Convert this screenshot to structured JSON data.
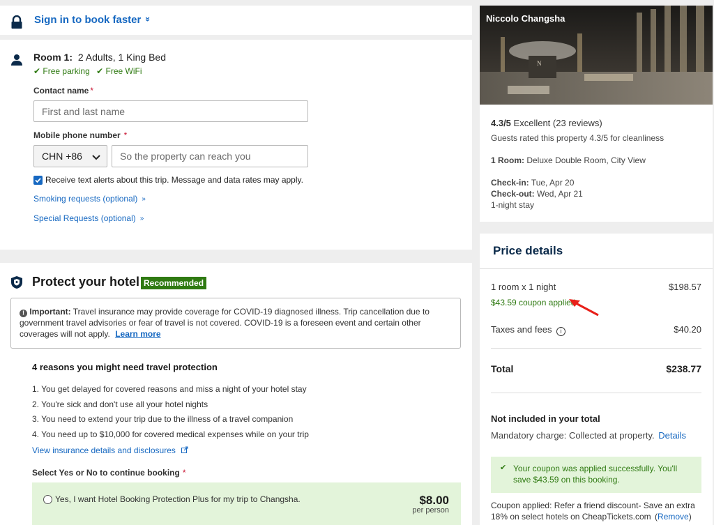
{
  "signin": {
    "label": "Sign in to book faster",
    "chevron": "»"
  },
  "room": {
    "title": "Room 1:",
    "details": "2 Adults, 1 King Bed",
    "amenities": [
      "Free parking",
      "Free WiFi"
    ],
    "contact_label": "Contact name",
    "contact_placeholder": "First and last name",
    "phone_label": "Mobile phone number",
    "country_code": "CHN +86",
    "phone_placeholder": "So the property can reach you",
    "sms_label": "Receive text alerts about this trip. Message and data rates may apply.",
    "sms_checked": true,
    "smoking_link": "Smoking requests (optional)",
    "special_link": "Special Requests (optional)"
  },
  "protect": {
    "title": "Protect your hotel",
    "badge": "Recommended",
    "important_label": "Important:",
    "important_text": "Travel insurance may provide coverage for COVID-19 diagnosed illness. Trip cancellation due to government travel advisories or fear of travel is not covered. COVID-19 is a foreseen event and certain other coverages will not apply.",
    "learn_more": "Learn more",
    "reasons_title": "4 reasons you might need travel protection",
    "reasons": [
      "1. You get delayed for covered reasons and miss a night of your hotel stay",
      "2. You're sick and don't use all your hotel nights",
      "3. You need to extend your trip due to the illness of a travel companion",
      "4. You need up to $10,000 for covered medical expenses while on your trip"
    ],
    "insurance_link": "View insurance details and disclosures",
    "select_label": "Select Yes or No to continue booking",
    "yes_option": "Yes, I want Hotel Booking Protection Plus for my trip to Changsha.",
    "price": "$8.00",
    "price_unit": "per person"
  },
  "hotel": {
    "name": "Niccolo Changsha",
    "rating": "4.3/5",
    "rating_word": "Excellent",
    "reviews": "(23 reviews)",
    "cleanliness": "Guests rated this property 4.3/5 for cleanliness",
    "room_label": "1 Room:",
    "room_type": "Deluxe Double Room, City View",
    "checkin_label": "Check-in:",
    "checkin": "Tue, Apr 20",
    "checkout_label": "Check-out:",
    "checkout": "Wed, Apr 21",
    "stay": "1-night stay"
  },
  "price": {
    "title": "Price details",
    "room_line": "1 room x 1 night",
    "room_amount": "$198.57",
    "coupon_line": "$43.59 coupon applied",
    "taxes_label": "Taxes and fees",
    "taxes_amount": "$40.20",
    "total_label": "Total",
    "total_amount": "$238.77",
    "not_included_title": "Not included in your total",
    "mandatory": "Mandatory charge: Collected at property.",
    "details_link": "Details",
    "coupon_success": "Your coupon was applied successfully. You'll save $43.59 on this booking.",
    "coupon_applied_text": "Coupon applied: Refer a friend discount- Save an extra 18% on select hotels on CheapTickets.com",
    "remove_open": "(",
    "remove_link": "Remove",
    "remove_close": ")"
  },
  "colors": {
    "link": "#1668c1",
    "green": "#2f7a12",
    "badge": "#2f7a12",
    "panel_green": "#e3f4da",
    "annotation_arrow": "#e8201a"
  },
  "icons": [
    "lock-icon",
    "person-icon",
    "check-icon",
    "shield-icon",
    "info-icon",
    "external-link-icon",
    "chevron-down-icon"
  ]
}
